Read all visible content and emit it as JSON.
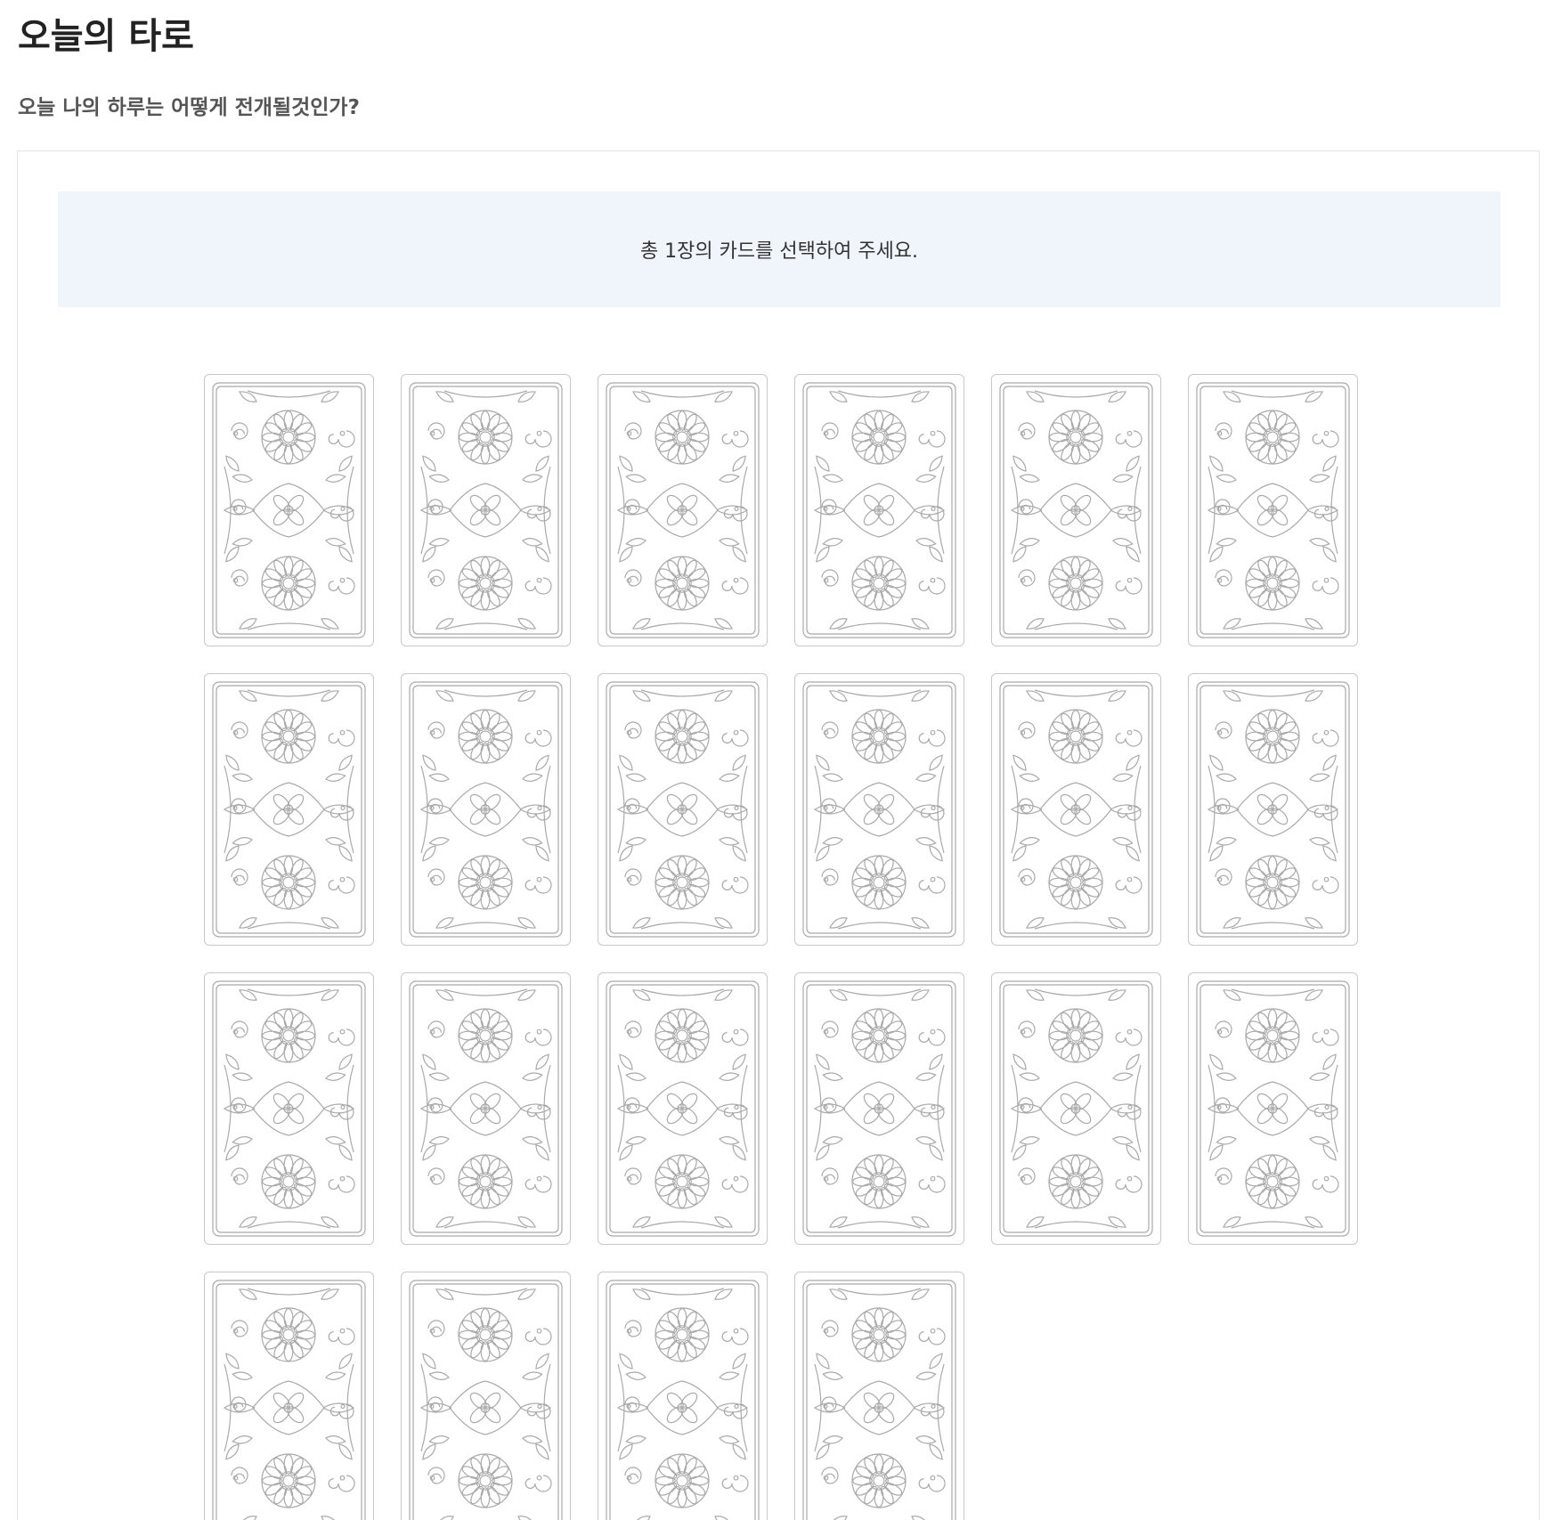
{
  "header": {
    "title": "오늘의 타로",
    "subtitle": "오늘 나의 하루는 어떻게 전개될것인가?"
  },
  "notice": {
    "text": "총 1장의 카드를 선택하여 주세요."
  },
  "cards": {
    "count": 22,
    "columns": 6,
    "icon": "tarot-card-back-icon",
    "pattern_color": "#a9a9a9"
  },
  "colors": {
    "notice_background": "#f0f5fc",
    "panel_border": "#e3e3e3",
    "card_border": "#c8c8c8"
  }
}
